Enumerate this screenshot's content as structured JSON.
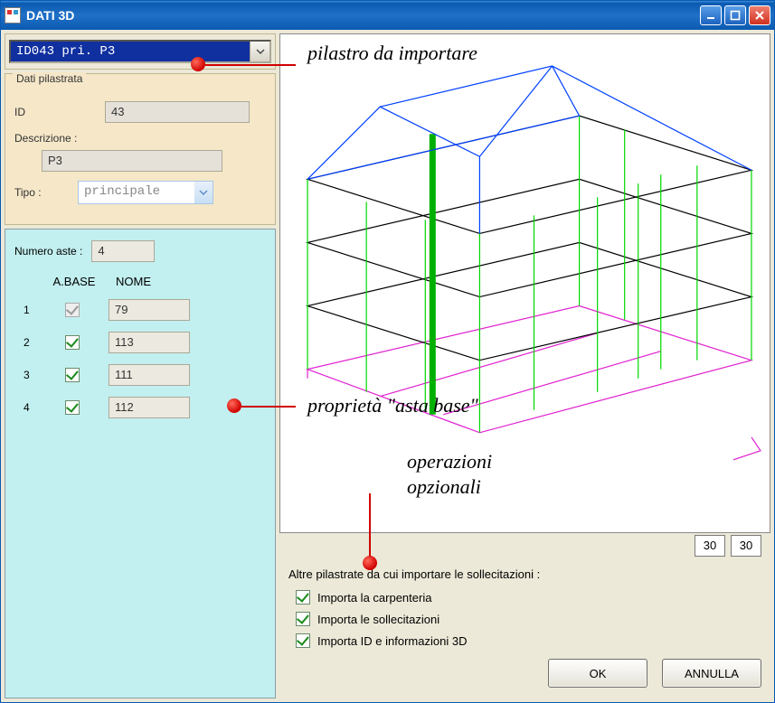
{
  "window": {
    "title": "DATI 3D"
  },
  "combo": {
    "selected": "ID043 pri. P3"
  },
  "pilastrata": {
    "legend": "Dati pilastrata",
    "id_label": "ID",
    "id_value": "43",
    "descr_label": "Descrizione :",
    "descr_value": "P3",
    "tipo_label": "Tipo :",
    "tipo_value": "principale"
  },
  "aste": {
    "count_label": "Numero aste :",
    "count_value": "4",
    "col_abase": "A.BASE",
    "col_nome": "NOME",
    "rows": [
      {
        "n": "1",
        "checked": true,
        "disabled": true,
        "nome": "79"
      },
      {
        "n": "2",
        "checked": true,
        "disabled": false,
        "nome": "113"
      },
      {
        "n": "3",
        "checked": true,
        "disabled": false,
        "nome": "111"
      },
      {
        "n": "4",
        "checked": true,
        "disabled": false,
        "nome": "112"
      }
    ]
  },
  "annotations": {
    "combo": "pilastro da importare",
    "asta": "proprietà \"asta base\"",
    "ops1": "operazioni",
    "ops2": "opzionali"
  },
  "coords": {
    "a": "30",
    "b": "30"
  },
  "imports": {
    "label": "Altre pilastrate da cui importare le sollecitazioni :",
    "opt1": "Importa la carpenteria",
    "opt2": "Importa le sollecitazioni",
    "opt3": "Importa ID e informazioni 3D"
  },
  "buttons": {
    "ok": "OK",
    "cancel": "ANNULLA"
  }
}
